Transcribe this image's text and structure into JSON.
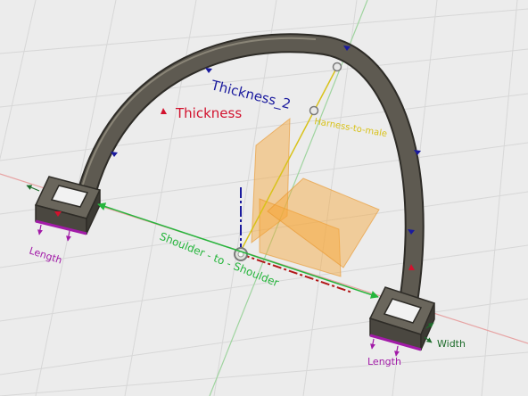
{
  "annotations": {
    "thickness": "Thickness",
    "thickness_2": "Thickness_2",
    "harness_to_male": "Harness-to-male",
    "shoulder_to_shoulder": "Shoulder - to - Shoulder",
    "length_left": "Length",
    "length_right": "Length",
    "width": "Width"
  },
  "colors": {
    "background": "#ececec",
    "grid": "#d7d7d7",
    "x_axis": "#e7a3a3",
    "y_axis": "#9fd49f",
    "frame_body": "#5e5a51",
    "frame_edge": "#2e2c27",
    "thickness": "#d2122e",
    "thickness_2": "#1a1a9e",
    "harness": "#d8c21a",
    "shoulder": "#26b53c",
    "length": "#a21ba8",
    "width": "#1d6b2a",
    "planes": "#f6a737"
  }
}
